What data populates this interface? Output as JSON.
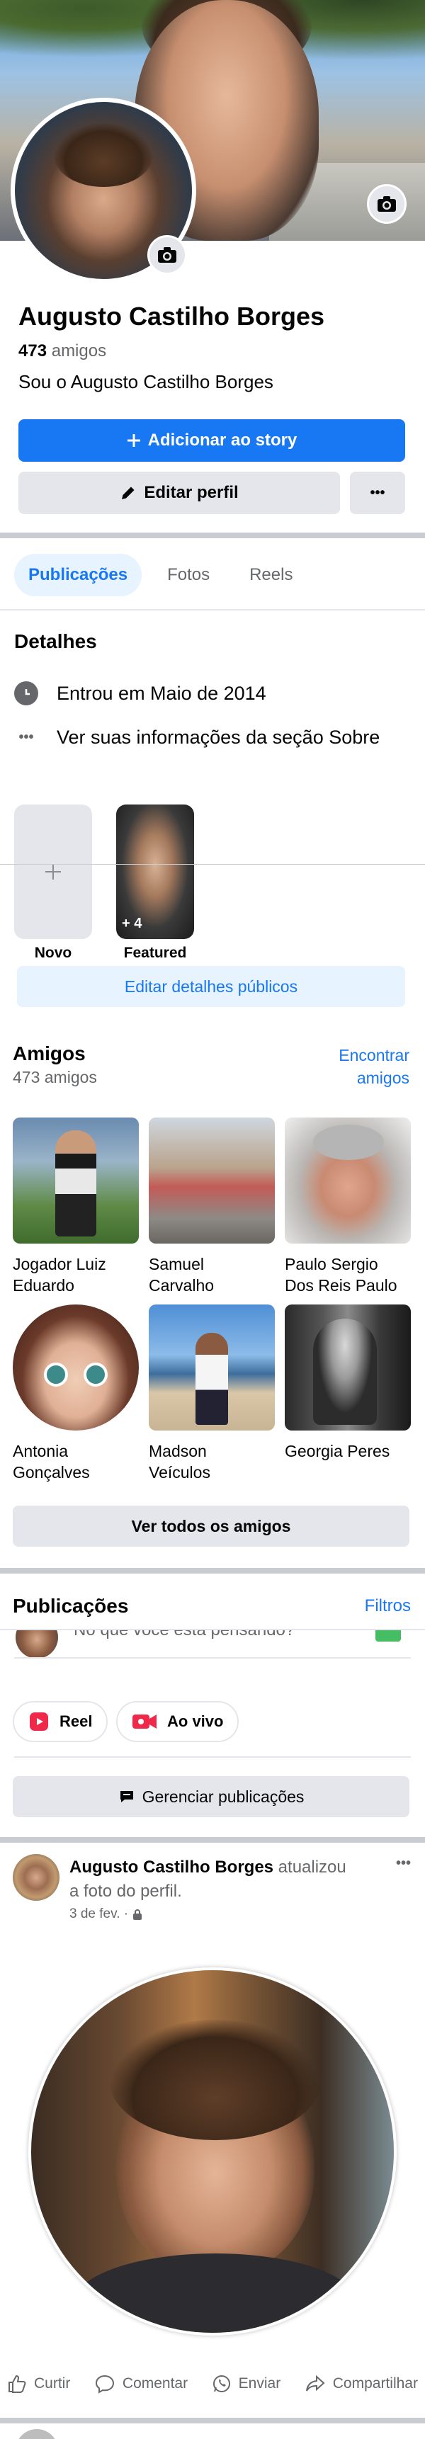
{
  "profile": {
    "name": "Augusto Castilho Borges",
    "friends_count": "473",
    "friends_word": "amigos",
    "bio": "Sou o Augusto Castilho Borges"
  },
  "actions": {
    "add_story": "Adicionar ao story",
    "edit_profile": "Editar perfil",
    "more": "•••"
  },
  "tabs": [
    {
      "label": "Publicações",
      "active": true
    },
    {
      "label": "Fotos",
      "active": false
    },
    {
      "label": "Reels",
      "active": false
    }
  ],
  "details": {
    "title": "Detalhes",
    "joined": "Entrou em Maio de 2014",
    "about": "Ver suas informações da seção Sobre",
    "featured_new": "Novo",
    "featured_label": "Featured",
    "featured_count": "+ 4",
    "edit_public": "Editar detalhes públicos"
  },
  "friends": {
    "title": "Amigos",
    "count_text": "473 amigos",
    "find_line1": "Encontrar",
    "find_line2": "amigos",
    "see_all": "Ver todos os amigos",
    "items": [
      {
        "line1": "Jogador Luiz",
        "line2": "Eduardo"
      },
      {
        "line1": "Samuel",
        "line2": "Carvalho"
      },
      {
        "line1": "Paulo Sergio",
        "line2": "Dos Reis Paulo"
      },
      {
        "line1": "Antonia",
        "line2": "Gonçalves"
      },
      {
        "line1": "Madson",
        "line2": "Veículos"
      },
      {
        "line1": "Georgia Peres",
        "line2": ""
      }
    ]
  },
  "posts": {
    "title": "Publicações",
    "filters": "Filtros",
    "composer_placeholder": "No que você está pensando?",
    "reel": "Reel",
    "live": "Ao vivo",
    "manage": "Gerenciar publicações"
  },
  "post": {
    "author": "Augusto Castilho Borges",
    "action_line1": " atualizou",
    "action_line2": "a foto do perfil.",
    "date": "3 de fev. ·",
    "like": "Curtir",
    "comment": "Comentar",
    "send": "Enviar",
    "share": "Compartilhar"
  },
  "colors": {
    "accent": "#1877f2",
    "secondary_text": "#65676b",
    "button_gray": "#e4e6eb"
  }
}
